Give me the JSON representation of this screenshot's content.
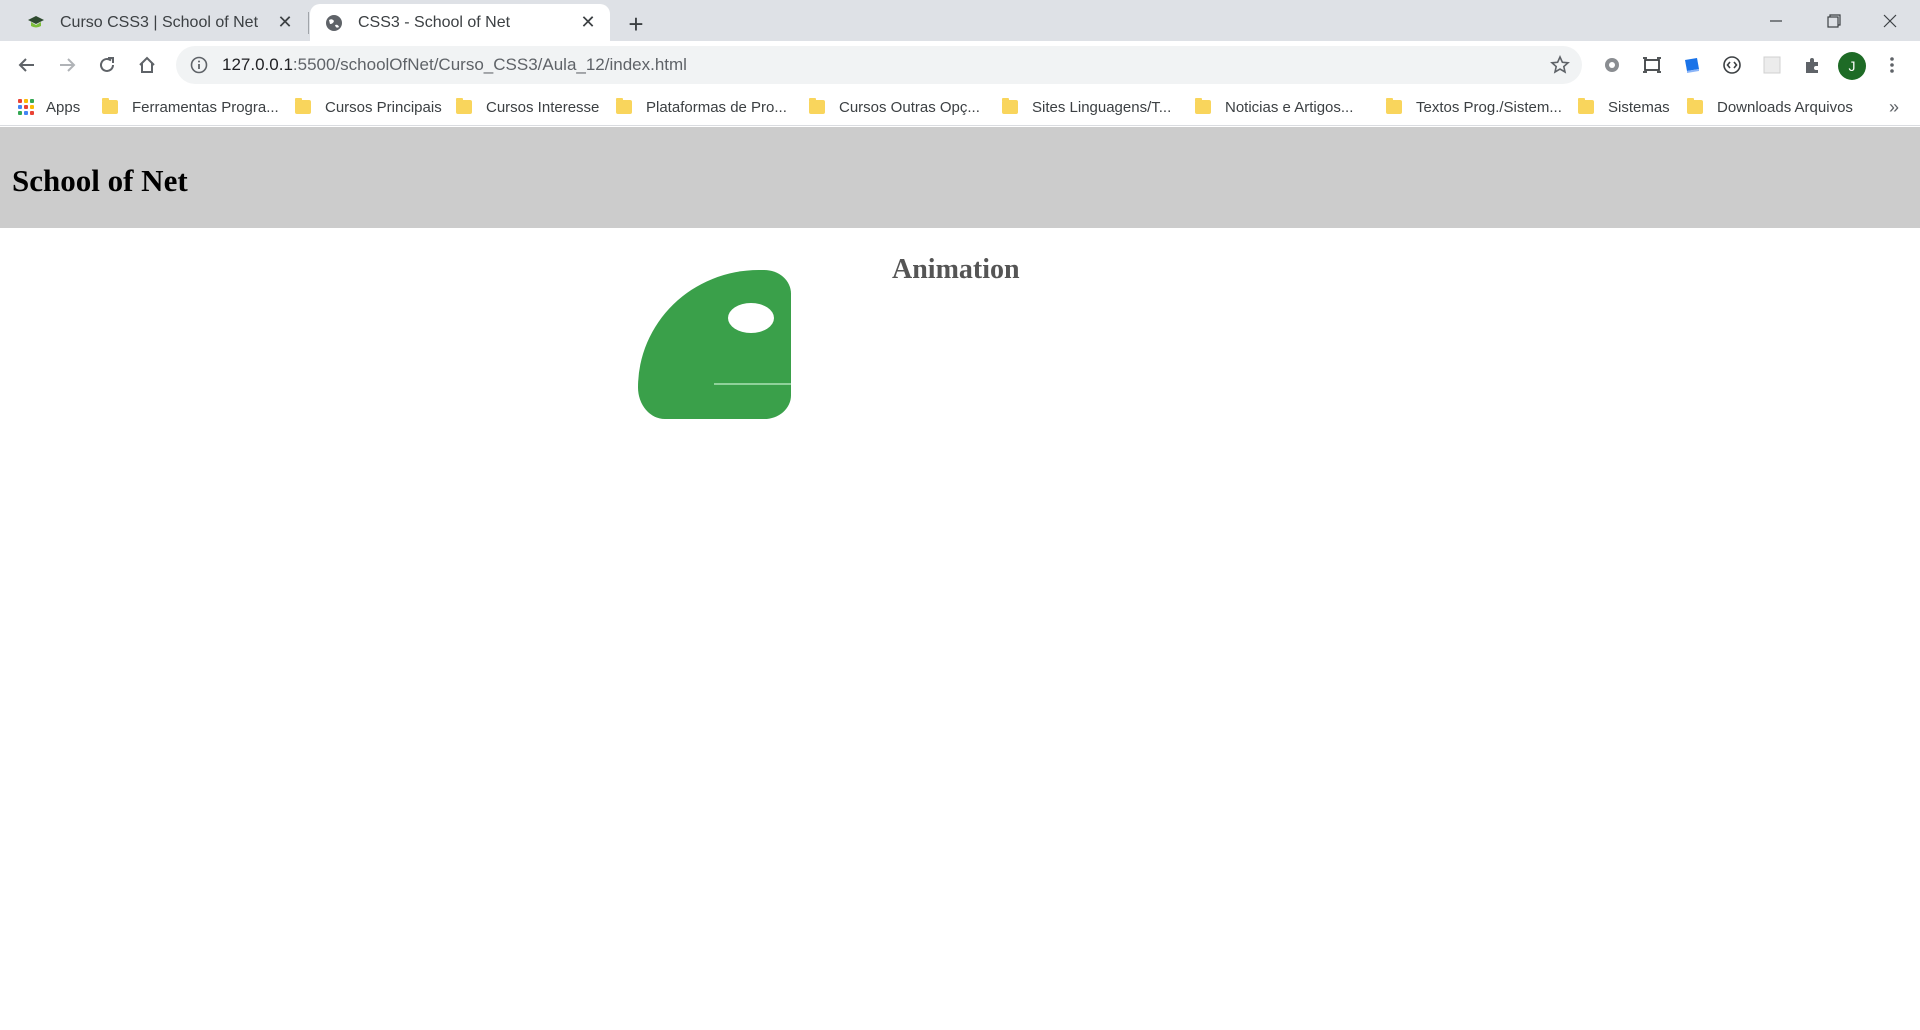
{
  "browser": {
    "tabs": [
      {
        "title": "Curso CSS3 | School of Net",
        "icon": "school-of-net-favicon",
        "active": false
      },
      {
        "title": "CSS3 - School of Net",
        "icon": "globe-icon",
        "active": true
      }
    ],
    "address": {
      "host": "127.0.0.1",
      "rest": ":5500/schoolOfNet/Curso_CSS3/Aula_12/index.html"
    },
    "profile_initial": "J",
    "bookmarks": [
      {
        "label": "Apps",
        "icon": "apps-grid-icon"
      },
      {
        "label": "Ferramentas Progra...",
        "icon": "folder-icon"
      },
      {
        "label": "Cursos Principais",
        "icon": "folder-icon"
      },
      {
        "label": "Cursos Interesse",
        "icon": "folder-icon"
      },
      {
        "label": "Plataformas de Pro...",
        "icon": "folder-icon"
      },
      {
        "label": "Cursos Outras Opç...",
        "icon": "folder-icon"
      },
      {
        "label": "Sites Linguagens/T...",
        "icon": "folder-icon"
      },
      {
        "label": "Noticias e Artigos...",
        "icon": "folder-icon"
      },
      {
        "label": "Textos Prog./Sistem...",
        "icon": "folder-icon"
      },
      {
        "label": "Sistemas",
        "icon": "folder-icon"
      },
      {
        "label": "Downloads Arquivos",
        "icon": "folder-icon"
      }
    ],
    "bookmarks_more": "»"
  },
  "page": {
    "header_title": "School of Net",
    "animation_title": "Animation",
    "colors": {
      "header_bg": "#cccccc",
      "blob": "#3aa04a",
      "title_text": "#555555"
    }
  }
}
